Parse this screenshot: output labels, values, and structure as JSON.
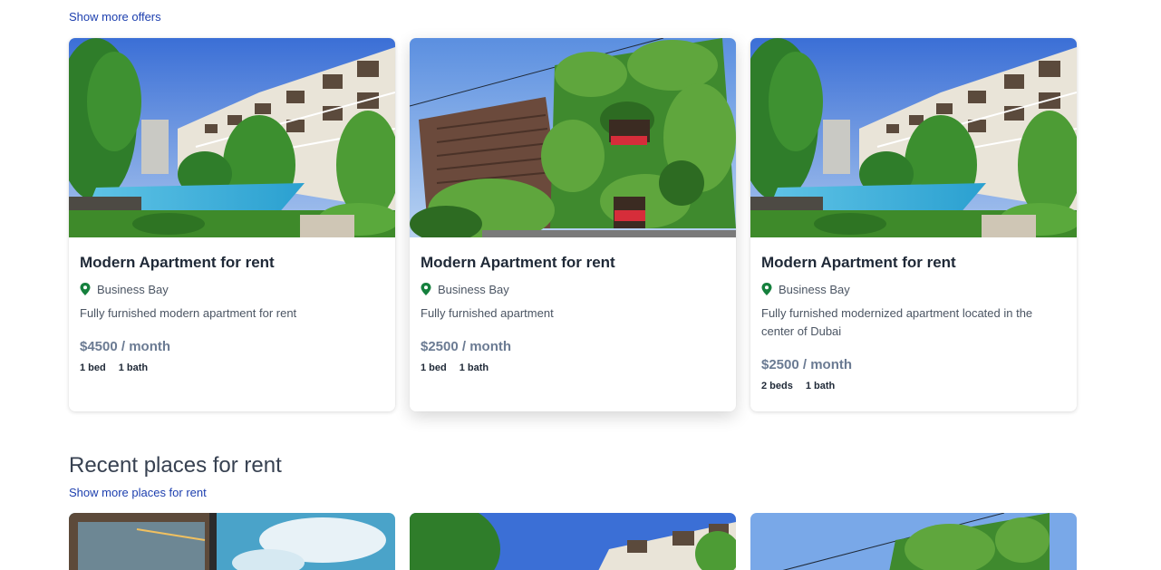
{
  "offers": {
    "show_more_label": "Show more offers",
    "cards": [
      {
        "image": "apartment-pool-photo",
        "title": "Modern Apartment for rent",
        "location": "Business Bay",
        "description": "Fully furnished modern apartment for rent",
        "price": "$4500 / month",
        "beds": "1 bed",
        "baths": "1 bath"
      },
      {
        "image": "ivy-house-photo",
        "title": "Modern Apartment for rent",
        "location": "Business Bay",
        "description": "Fully furnished apartment",
        "price": "$2500 / month",
        "beds": "1 bed",
        "baths": "1 bath"
      },
      {
        "image": "apartment-pool-photo",
        "title": "Modern Apartment for rent",
        "location": "Business Bay",
        "description": "Fully furnished modernized apartment located in the center of Dubai",
        "price": "$2500 / month",
        "beds": "2 beds",
        "baths": "1 bath"
      }
    ]
  },
  "recent": {
    "title": "Recent places for rent",
    "show_more_label": "Show more places for rent",
    "cards": [
      {
        "image": "modern-building-sky-photo"
      },
      {
        "image": "apartment-pool-photo"
      },
      {
        "image": "ivy-house-photo"
      }
    ]
  },
  "colors": {
    "link": "#1e40af",
    "pin": "#15803d",
    "price": "#6b7b93",
    "title": "#1f2937"
  },
  "icons": {
    "location": "map-pin-icon"
  }
}
